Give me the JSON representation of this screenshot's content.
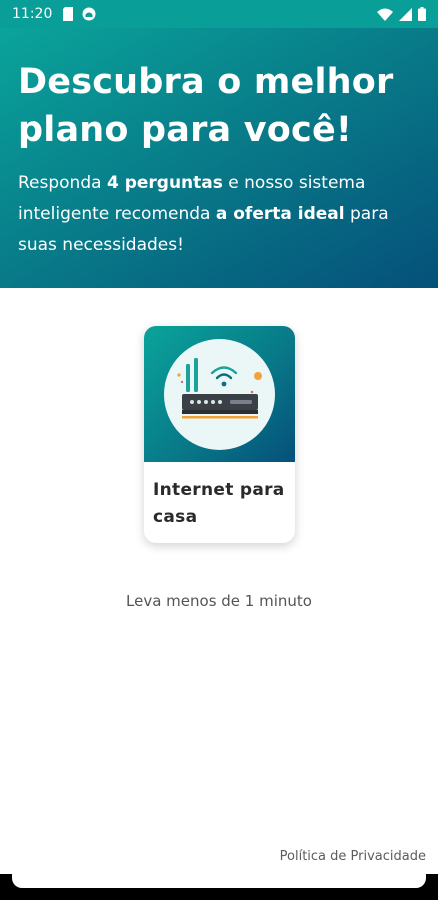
{
  "status_bar": {
    "time": "11:20",
    "left_icons": [
      "sd-card-icon",
      "app-notification-icon"
    ],
    "right_icons": [
      "wifi-icon",
      "cell-signal-icon",
      "battery-icon"
    ]
  },
  "hero": {
    "title": "Descubra o melhor plano para você!",
    "subtitle_parts": {
      "p1": "Responda ",
      "b1": "4 perguntas",
      "p2": " e nosso sistema inteligente recomenda ",
      "b2": "a oferta ideal",
      "p3": " para suas necessidades!"
    },
    "background_colors": [
      "#0aa49b",
      "#087a88",
      "#05507a"
    ]
  },
  "card": {
    "label": "Internet para casa",
    "image_icon": "wifi-router-icon"
  },
  "time_note": "Leva menos de 1 minuto",
  "footer": {
    "privacy_link": "Política de Privacidade"
  }
}
